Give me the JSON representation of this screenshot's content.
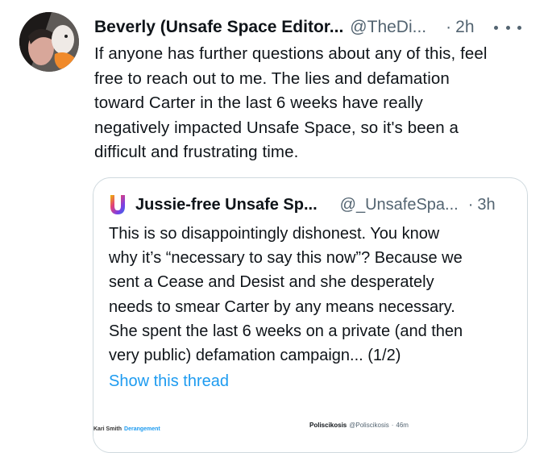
{
  "author": {
    "name": "Beverly (Unsafe Space Editor...",
    "handle": "@TheDi...",
    "separator": "·",
    "time": "2h"
  },
  "icons": {
    "more": "more-horizontal-icon",
    "quote_logo": "unsafe-space-u-logo-icon"
  },
  "tweet": {
    "lines": [
      "If anyone has further questions about any of this, feel",
      "free to reach out to me. The lies and defamation",
      "toward Carter in the last 6 weeks have really",
      "negatively impacted Unsafe Space, so it's been a",
      "difficult and frustrating time."
    ]
  },
  "quote": {
    "name": "Jussie-free Unsafe Sp...",
    "handle": "@_UnsafeSpa...",
    "separator": "·",
    "time": "3h",
    "lines": [
      "This is so disappointingly dishonest. You know",
      "why it’s “necessary to say this now”? Because we",
      "sent a Cease and Desist and she desperately",
      "needs to smear Carter by any means necessary.",
      "She spent the last 6 weeks on a private (and then",
      "very public) defamation campaign... (1/2)"
    ],
    "show_thread": "Show this thread",
    "embedded": {
      "left_name": "Kari Smith",
      "left_handle": "Derangement",
      "right_name": "Poliscikosis",
      "right_handle": "@Poliscikosis",
      "right_separator": "·",
      "right_time": "46m"
    }
  },
  "colors": {
    "link": "#1d9bf0",
    "secondary_text": "#536471",
    "border": "#cfd9de"
  }
}
